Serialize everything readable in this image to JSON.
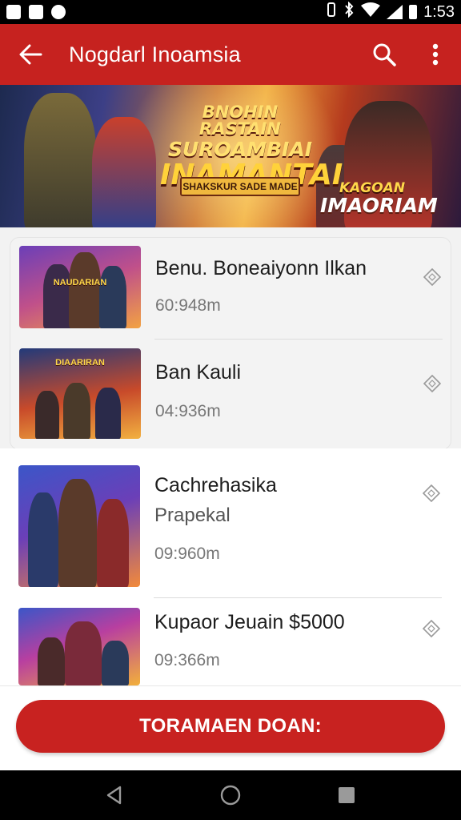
{
  "status_bar": {
    "time": "1:53",
    "left_icons": [
      "notification-icon",
      "gallery-icon",
      "messenger-icon"
    ],
    "right_icons": [
      "vibrate-icon",
      "bluetooth-icon",
      "wifi-icon",
      "signal-icon",
      "battery-icon"
    ]
  },
  "app_bar": {
    "title": "Nogdarl Inoamsia",
    "back_icon": "arrow-left-icon",
    "search_icon": "search-icon",
    "more_icon": "more-vert-icon",
    "color": "#c6221f"
  },
  "banner": {
    "title_line1": "BNOHIN RASTAIN",
    "title_line2": "SUROAMBIAI",
    "title_line3": "INAMANTAI",
    "ribbon": "SHAKSKUR SADE MADE",
    "badge_line1": "KAGOAN",
    "badge_line2": "IMAORIAM"
  },
  "list": {
    "items": [
      {
        "title": "Benu. Boneaiyonn Ilkan",
        "subtitle": "",
        "meta": "60:948m",
        "action_icon": "diamond-icon"
      },
      {
        "title": "Ban Kauli",
        "subtitle": "",
        "meta": "04:936m",
        "action_icon": "diamond-icon"
      },
      {
        "title": "Cachrehasika",
        "subtitle": "Prapekal",
        "meta": "09:960m",
        "action_icon": "diamond-icon"
      },
      {
        "title": "Kupaor Jeuain $5000",
        "subtitle": "",
        "meta": "09:366m",
        "action_icon": "diamond-icon"
      }
    ],
    "thumb_texts": [
      "NAUDARIAN",
      "DIAARIRAN",
      "",
      ""
    ]
  },
  "cta": {
    "label": "TORAMAEN DOAN:",
    "color": "#c82220"
  },
  "nav_bar": {
    "back_icon": "nav-back-icon",
    "home_icon": "nav-home-icon",
    "recents_icon": "nav-recents-icon"
  }
}
